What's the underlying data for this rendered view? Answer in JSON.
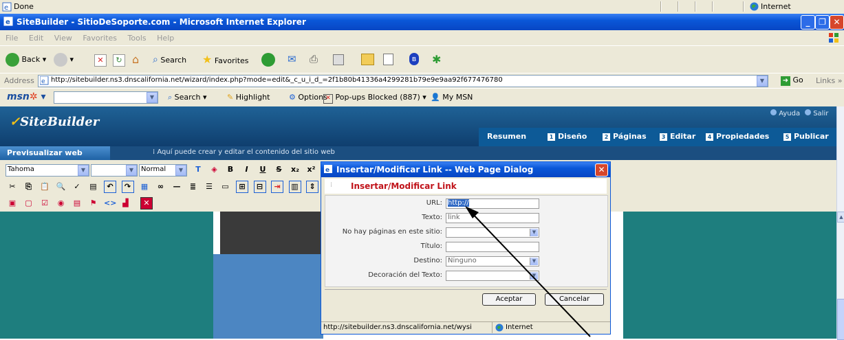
{
  "top_status": {
    "text": "Done",
    "zone": "Internet"
  },
  "window": {
    "title": "SiteBuilder - SitioDeSoporte.com - Microsoft Internet Explorer"
  },
  "menu": [
    "File",
    "Edit",
    "View",
    "Favorites",
    "Tools",
    "Help"
  ],
  "toolbar": {
    "back": "Back",
    "search": "Search",
    "favorites": "Favorites"
  },
  "address": {
    "label": "Address",
    "url": "http://sitebuilder.ns3.dnscalifornia.net/wizard/index.php?mode=edit&_c_u_i_d_=2f1b80b41336a4299281b79e9e9aa92f677476780",
    "go": "Go",
    "links": "Links"
  },
  "msn": {
    "logo": "msn",
    "search": "Search",
    "highlight": "Highlight",
    "options": "Options",
    "popups": "Pop-ups Blocked (887)",
    "mymsn": "My MSN"
  },
  "site": {
    "logo": "SiteBuilder",
    "help": "Ayuda",
    "exit": "Salir",
    "nav": [
      {
        "num": "",
        "label": "Resumen"
      },
      {
        "num": "1",
        "label": "Diseño"
      },
      {
        "num": "2",
        "label": "Páginas"
      },
      {
        "num": "3",
        "label": "Editar"
      },
      {
        "num": "4",
        "label": "Propiedades"
      },
      {
        "num": "5",
        "label": "Publicar"
      }
    ],
    "preview_button": "Previsualizar web",
    "info": "Aquí puede crear y editar el contenido del sitio web",
    "font": "Tahoma",
    "style": "Normal"
  },
  "dialog": {
    "title": "Insertar/Modificar Link -- Web Page Dialog",
    "header": "Insertar/Modificar Link",
    "fields": {
      "url_label": "URL:",
      "url_value": "http://",
      "text_label": "Texto:",
      "text_value": "link",
      "pages_label": "No hay páginas en este sitio:",
      "title_label": "Título:",
      "target_label": "Destino:",
      "target_value": "Ninguno",
      "decoration_label": "Decoración del Texto:"
    },
    "accept": "Aceptar",
    "cancel": "Cancelar",
    "status_url": "http://sitebuilder.ns3.dnscalifornia.net/wysi",
    "status_zone": "Internet"
  },
  "colors": {
    "xp_blue": "#0a57d8",
    "header_red": "#c0131a",
    "teal": "#1e7e7e",
    "arrow": "#000000"
  }
}
